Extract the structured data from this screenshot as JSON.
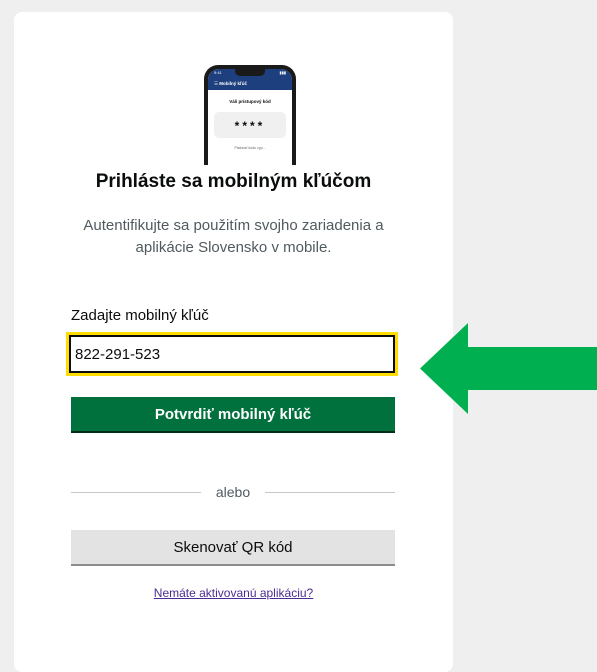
{
  "phone": {
    "status_time": "9:41",
    "header": "Mobilný kľúč",
    "label": "Váš prístupový kód",
    "code": "****",
    "footer": "Platnosť kódu vyp..."
  },
  "title": "Prihláste sa mobilným kľúčom",
  "subtitle": "Autentifikujte sa použitím svojho zariadenia a aplikácie Slovensko v mobile.",
  "form": {
    "label": "Zadajte mobilný kľúč",
    "value": "822-291-523",
    "submit_label": "Potvrdiť mobilný kľúč"
  },
  "divider_text": "alebo",
  "qr_button_label": "Skenovať QR kód",
  "no_app_link": "Nemáte aktivovanú aplikáciu?",
  "colors": {
    "primary": "#00703c",
    "focus": "#ffdd00",
    "arrow": "#00b050",
    "link": "#4c2c92"
  }
}
